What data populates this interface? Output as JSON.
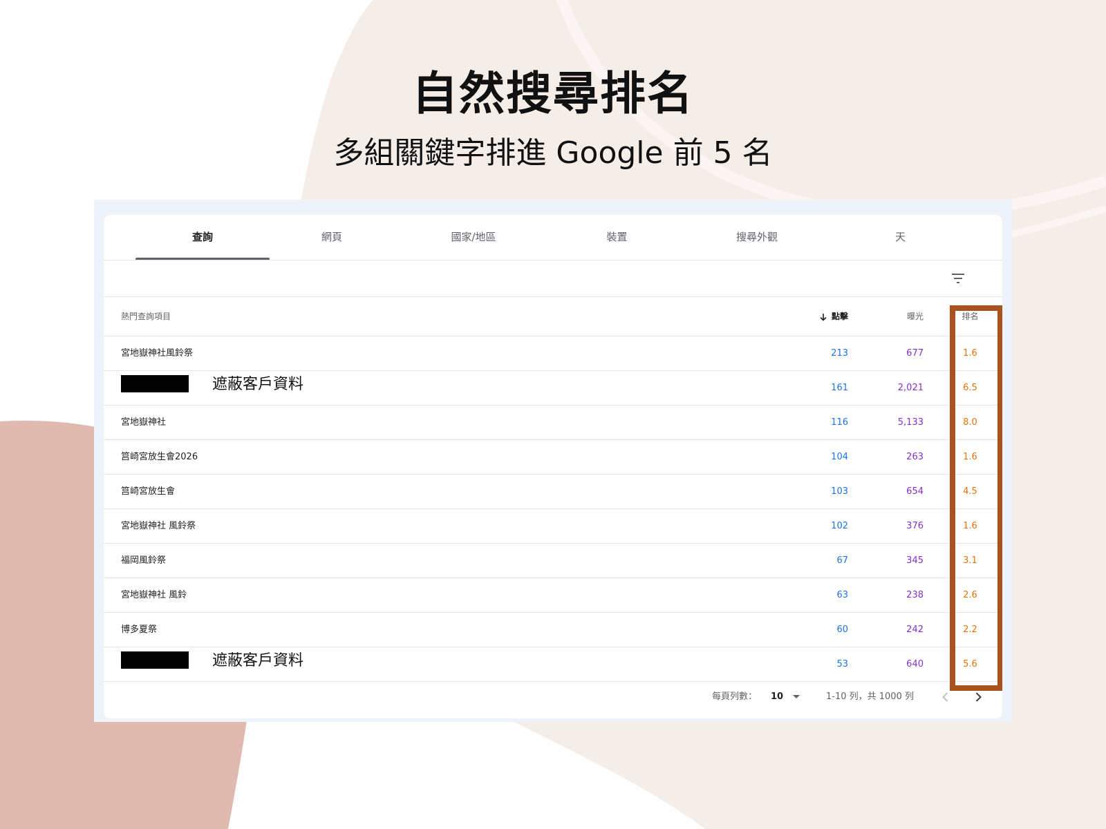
{
  "slide": {
    "title": "自然搜尋排名",
    "subtitle": "多組關鍵字排進 Google 前 5 名",
    "bg_colors": {
      "blush": "#f4ede8",
      "rose": "#e0bab0",
      "arc": "#fbf6f3"
    },
    "highlight_color": "#a9521e"
  },
  "tabs": [
    {
      "label": "查詢",
      "active": true
    },
    {
      "label": "網頁"
    },
    {
      "label": "國家/地區"
    },
    {
      "label": "裝置"
    },
    {
      "label": "搜尋外觀"
    },
    {
      "label": "天"
    }
  ],
  "toolbar": {
    "filter_icon": "filter-icon"
  },
  "table": {
    "headers": {
      "query": "熱門查詢項目",
      "clicks": "點擊",
      "impressions": "曝光",
      "position": "排名"
    },
    "sort_icon": "arrow-down-icon",
    "rows": [
      {
        "query": "宮地嶽神社風鈴祭",
        "clicks": "213",
        "impressions": "677",
        "position": "1.6"
      },
      {
        "query": "",
        "masked": true,
        "mask_label": "遮蔽客戶資料",
        "clicks": "161",
        "impressions": "2,021",
        "position": "6.5"
      },
      {
        "query": "宮地嶽神社",
        "clicks": "116",
        "impressions": "5,133",
        "position": "8.0"
      },
      {
        "query": "筥崎宮放生會2026",
        "clicks": "104",
        "impressions": "263",
        "position": "1.6"
      },
      {
        "query": "筥崎宮放生會",
        "clicks": "103",
        "impressions": "654",
        "position": "4.5"
      },
      {
        "query": "宮地嶽神社 風鈴祭",
        "clicks": "102",
        "impressions": "376",
        "position": "1.6"
      },
      {
        "query": "福岡風鈴祭",
        "clicks": "67",
        "impressions": "345",
        "position": "3.1"
      },
      {
        "query": "宮地嶽神社 風鈴",
        "clicks": "63",
        "impressions": "238",
        "position": "2.6"
      },
      {
        "query": "博多夏祭",
        "clicks": "60",
        "impressions": "242",
        "position": "2.2"
      },
      {
        "query": "",
        "masked": true,
        "mask_label": "遮蔽客戶資料",
        "clicks": "53",
        "impressions": "640",
        "position": "5.6"
      }
    ]
  },
  "footer": {
    "rows_per_page_label": "每頁列數：",
    "rows_per_page_value": "10",
    "range_text": "1-10 列，共 1000 列",
    "prev_icon": "chevron-left-icon",
    "next_icon": "chevron-right-icon"
  }
}
